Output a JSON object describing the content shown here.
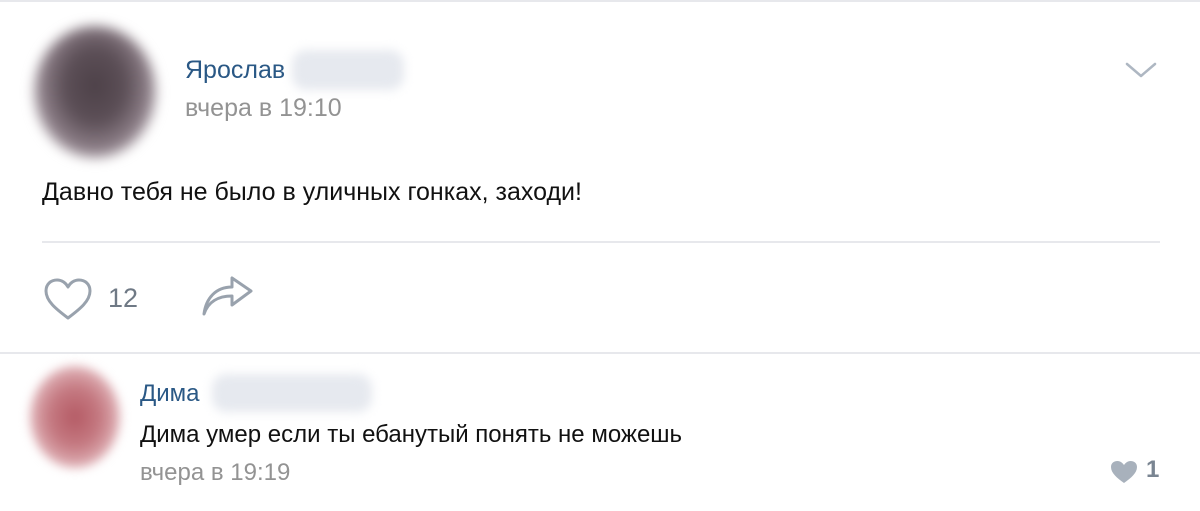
{
  "post": {
    "author": "Ярослав",
    "timestamp": "вчера в 19:10",
    "text": "Давно тебя не было в уличных гонках, заходи!",
    "likes": "12"
  },
  "comment": {
    "author": "Дима",
    "text": "Дима умер если ты ебанутый понять не можешь",
    "timestamp": "вчера в 19:19",
    "likes": "1"
  },
  "icons": {
    "menu": "chevron-down-icon",
    "like": "heart-icon",
    "share": "share-arrow-icon",
    "comment_like": "heart-filled-icon"
  },
  "colors": {
    "link": "#2a5885",
    "meta": "#939393",
    "icon": "#99a2ad",
    "divider": "#e7e8ec"
  }
}
